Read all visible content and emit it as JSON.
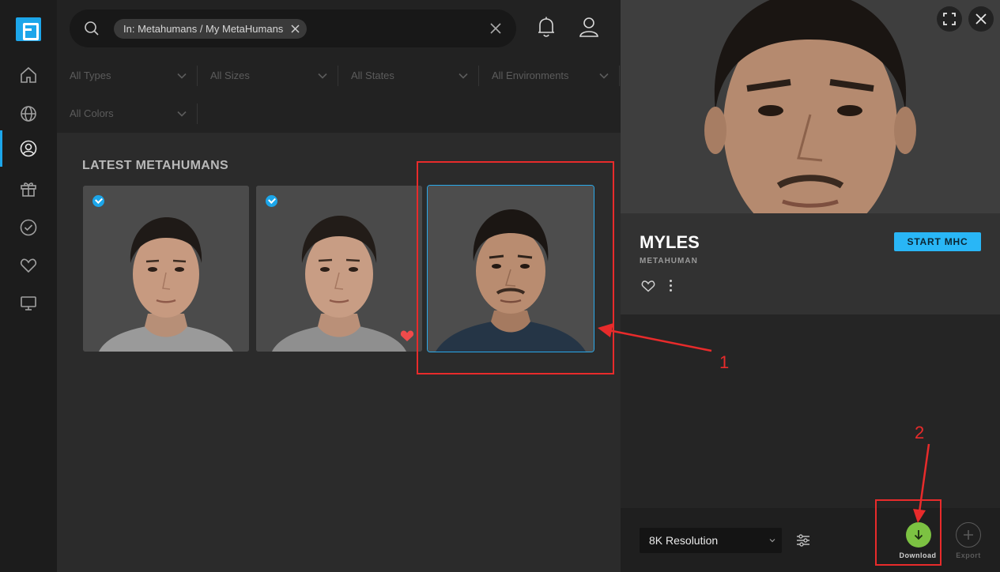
{
  "app": {
    "brand_color": "#1ca6ea"
  },
  "sidebar": {
    "items": [
      {
        "icon": "home-icon"
      },
      {
        "icon": "globe-icon"
      },
      {
        "icon": "user-circle-icon",
        "active": true
      },
      {
        "icon": "gift-icon"
      },
      {
        "icon": "check-circle-icon"
      },
      {
        "icon": "heart-icon"
      },
      {
        "icon": "monitor-icon"
      }
    ]
  },
  "search": {
    "chip_label": "In: Metahumans / My MetaHumans",
    "value": ""
  },
  "filters": [
    {
      "label": "All Types"
    },
    {
      "label": "All Sizes"
    },
    {
      "label": "All States"
    },
    {
      "label": "All Environments"
    },
    {
      "label": "All Colors"
    }
  ],
  "main": {
    "section_title": "LATEST METAHUMANS",
    "cards": [
      {
        "checked": true,
        "favorite": false,
        "selected": false
      },
      {
        "checked": true,
        "favorite": true,
        "selected": false
      },
      {
        "checked": false,
        "favorite": false,
        "selected": true
      }
    ]
  },
  "detail": {
    "name": "MYLES",
    "type": "METAHUMAN",
    "start_button": "START MHC",
    "resolution": "8K Resolution",
    "download_label": "Download",
    "export_label": "Export"
  },
  "annotations": {
    "color": "#e82b2b",
    "marker_1": "1",
    "marker_2": "2"
  }
}
